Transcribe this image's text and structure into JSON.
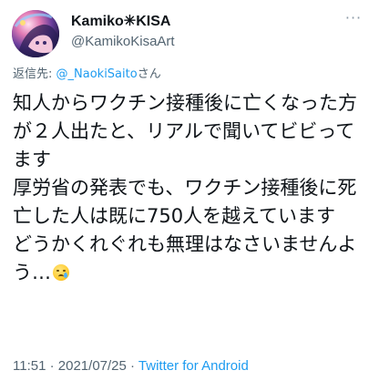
{
  "author": {
    "display_name": "Kamiko✳KISA",
    "handle": "@KamikoKisaArt",
    "avatar_icon": "avatar-illustration"
  },
  "header": {
    "more_icon": "more-horizontal-icon",
    "more_label": "···"
  },
  "reply": {
    "prefix": "返信先: ",
    "mention": "@_NaokiSaito",
    "suffix": "さん"
  },
  "tweet": {
    "text": "知人からワクチン接種後に亡くなった方が２人出たと、リアルで聞いてビビってます\n厚労省の発表でも、ワクチン接種後に死亡した人は既に750人を越えています\nどうかくれぐれも無理はなさいませんよう…",
    "emoji_icon": "crying-face-emoji"
  },
  "meta": {
    "time": "11:51",
    "separator1": " · ",
    "date": "2021/07/25",
    "separator2": " · ",
    "source": "Twitter for Android"
  },
  "colors": {
    "accent": "#1d9bf0",
    "secondary_text": "#536471",
    "primary_text": "#0f1419"
  }
}
